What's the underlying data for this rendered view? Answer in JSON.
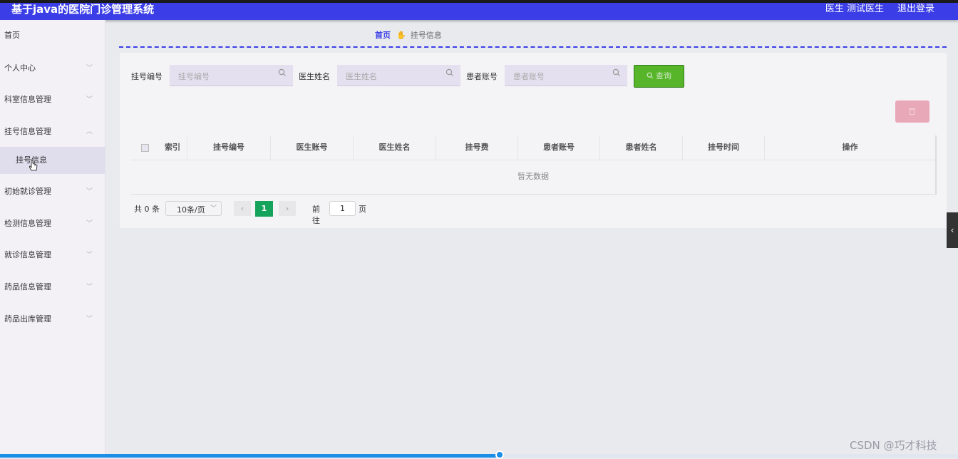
{
  "header": {
    "title": "基于java的医院门诊管理系统",
    "user": "医生 测试医生",
    "logout": "退出登录"
  },
  "sidebar": {
    "items": [
      {
        "label": "首页"
      },
      {
        "label": "个人中心"
      },
      {
        "label": "科室信息管理"
      },
      {
        "label": "挂号信息管理"
      },
      {
        "label": "初始就诊管理"
      },
      {
        "label": "检测信息管理"
      },
      {
        "label": "就诊信息管理"
      },
      {
        "label": "药品信息管理"
      },
      {
        "label": "药品出库管理"
      }
    ],
    "submenu": {
      "label": "挂号信息"
    }
  },
  "breadcrumb": {
    "home": "首页",
    "current": "挂号信息",
    "icon": "hand-icon"
  },
  "search": {
    "fields": [
      {
        "label": "挂号编号",
        "placeholder": "挂号编号"
      },
      {
        "label": "医生姓名",
        "placeholder": "医生姓名"
      },
      {
        "label": "患者账号",
        "placeholder": "患者账号"
      }
    ],
    "query_button": "查询"
  },
  "actions": {
    "delete_icon": "trash-icon",
    "delete_color": "#e9a8b8",
    "query_color": "#57b52a"
  },
  "table": {
    "headers": [
      "索引",
      "挂号编号",
      "医生账号",
      "医生姓名",
      "挂号费",
      "患者账号",
      "患者姓名",
      "挂号时间",
      "操作"
    ],
    "rows": [],
    "empty_text": "暂无数据"
  },
  "pagination": {
    "total": "共 0 条",
    "page_size": "10条/页",
    "current_page": "1",
    "goto_label": "前往",
    "goto_value": "1",
    "page_unit": "页"
  },
  "watermark": "CSDN @巧才科技",
  "video_progress": 0.52,
  "colors": {
    "header_bg": "#3b3ee6",
    "active_page": "#16a35b"
  }
}
